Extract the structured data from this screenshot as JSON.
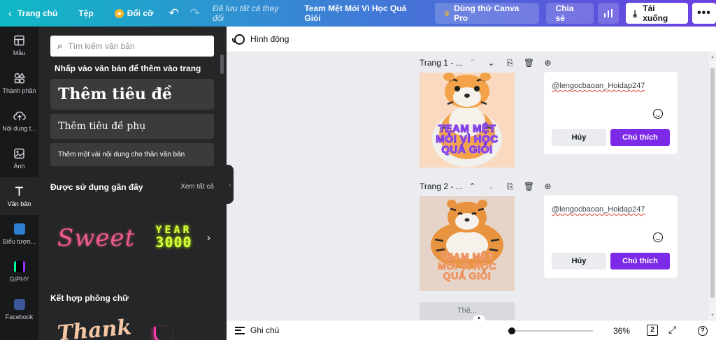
{
  "topbar": {
    "home": "Trang chủ",
    "file": "Tệp",
    "resize": "Đổi cỡ",
    "saved_status": "Đã lưu tất cả thay đổi",
    "doc_title": "Team Mệt Mỏi Vì Học Quá Giỏi",
    "trial": "Dùng thử Canva Pro",
    "share": "Chia sẻ",
    "download": "Tải xuống",
    "gradient_colors": [
      "#0fb9c5",
      "#3b82d6",
      "#6b3fe0"
    ]
  },
  "rail": {
    "items": [
      {
        "label": "Mẫu",
        "icon": "template-icon"
      },
      {
        "label": "Thành phần",
        "icon": "elements-icon"
      },
      {
        "label": "Nội dung t...",
        "icon": "upload-icon"
      },
      {
        "label": "Ảnh",
        "icon": "photo-icon"
      },
      {
        "label": "Văn bản",
        "icon": "text-icon"
      },
      {
        "label": "Biểu tượn...",
        "icon": "bitmoji-icon"
      },
      {
        "label": "GIPHY",
        "icon": "giphy-icon"
      },
      {
        "label": "Facebook",
        "icon": "facebook-icon"
      }
    ],
    "active_index": 4
  },
  "panel": {
    "search_placeholder": "Tìm kiếm văn bản",
    "hint": "Nhấp vào văn bản để thêm vào trang",
    "add_heading": "Thêm tiêu đề",
    "add_subheading": "Thêm tiêu đề phụ",
    "add_body": "Thêm một vài nội dung cho thân văn bản",
    "recent_title": "Được sử dụng gần đây",
    "see_all": "Xem tất cả",
    "recent_items": [
      "Sweet",
      "YEAR",
      "3000"
    ],
    "combos_title": "Kết hợp phông chữ",
    "combo_items": [
      "Thank"
    ]
  },
  "editor": {
    "toolbar_label": "Hình động",
    "pages": [
      {
        "title": "Trang 1 - ...",
        "caption_lines": [
          "TEAM MỆT",
          "MỎI VÌ HỌC",
          "QUÁ GIỎI"
        ]
      },
      {
        "title": "Trang 2 - ...",
        "caption_lines": [
          "TEAM MỆT",
          "MỎI VÌ HỌC",
          "QUÁ GIỎI"
        ]
      }
    ],
    "comments": [
      {
        "text": "@lengocbaoan_Hoidap247",
        "cancel": "Hủy",
        "submit": "Chú thích"
      },
      {
        "text": "@lengocbaoan_Hoidap247",
        "cancel": "Hủy",
        "submit": "Chú thích"
      }
    ],
    "add_page_label": "Thê..."
  },
  "footer": {
    "notes": "Ghi chú",
    "zoom": "36%",
    "zoom_fraction": 0.36,
    "page_count": "2"
  }
}
